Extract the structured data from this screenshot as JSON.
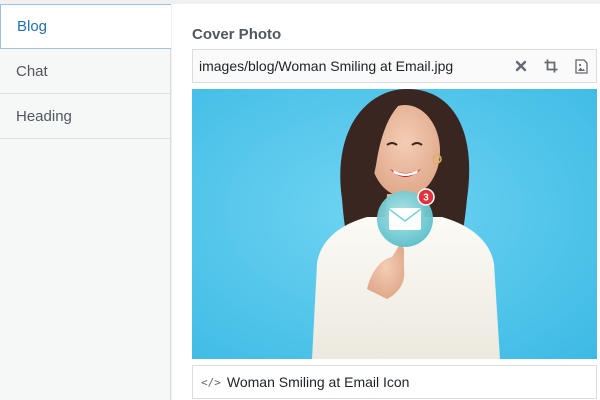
{
  "tabs": [
    {
      "label": "Blog",
      "active": true
    },
    {
      "label": "Chat",
      "active": false
    },
    {
      "label": "Heading",
      "active": false
    }
  ],
  "field": {
    "title": "Cover Photo",
    "path_value": "images/blog/Woman Smiling at Email.jpg",
    "actions": [
      "clear-icon",
      "crop-icon",
      "image-icon"
    ]
  },
  "image": {
    "notification_count": "3",
    "alt_text": "Woman Smiling at Email Icon"
  },
  "colors": {
    "accent": "#2271b1",
    "background_blue": "#48c2e8",
    "badge": "#e0333c"
  }
}
